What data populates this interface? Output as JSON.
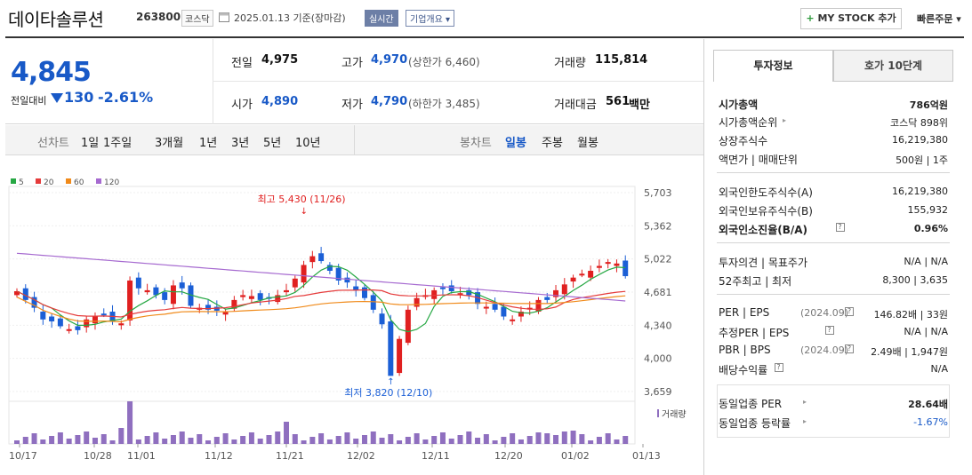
{
  "header": {
    "name": "데이타솔루션",
    "code": "263800",
    "market": "코스닥",
    "date": "2025.01.13 기준(장마감)",
    "live": "실시간",
    "corp": "기업개요 ▾",
    "mystock_plus": "+",
    "mystock": "MY STOCK 추가",
    "quick": "빠른주문 ▾"
  },
  "summary": {
    "price": "4,845",
    "chg_label": "전일대비",
    "chg": "130",
    "rate": "-2.61%",
    "prev_label": "전일",
    "prev": "4,975",
    "high_label": "고가",
    "high": "4,970",
    "upper": "(상한가 6,460)",
    "volume_label": "거래량",
    "volume": "115,814",
    "open_label": "시가",
    "open": "4,890",
    "low_label": "저가",
    "low": "4,790",
    "lower": "(하한가 3,485)",
    "amount_label": "거래대금",
    "amount": "561",
    "amount_unit": "백만"
  },
  "periods": {
    "line_title": "선차트",
    "line": [
      "1일",
      "1주일",
      "3개월",
      "1년",
      "3년",
      "5년",
      "10년"
    ],
    "candle_title": "봉차트",
    "candle": [
      "일봉",
      "주봉",
      "월봉"
    ],
    "candle_selected": 0
  },
  "chart_data": {
    "type": "candlestick",
    "legend": [
      {
        "name": "5",
        "color": "#27a844"
      },
      {
        "name": "20",
        "color": "#e53b3b"
      },
      {
        "name": "60",
        "color": "#f08a1a"
      },
      {
        "name": "120",
        "color": "#a66ad0"
      }
    ],
    "y_ticks": [
      "5,703",
      "5,362",
      "5,022",
      "4,681",
      "4,340",
      "4,000",
      "3,659"
    ],
    "ylim": [
      3659,
      5703
    ],
    "x_ticks": [
      "10/17",
      "10/28",
      "11/01",
      "11/12",
      "11/21",
      "12/02",
      "12/11",
      "12/20",
      "01/02",
      "01/13"
    ],
    "max_label": "최고 5,430 (11/26)",
    "min_label": "최저 3,820 (12/10)",
    "volume_label": "거래량",
    "up_color": "#e02020",
    "down_color": "#1b5fd6",
    "volume_color": "#8f6fbf"
  },
  "side": {
    "tab1": "투자정보",
    "tab2": "호가 10단계",
    "rows": [
      {
        "k": "시가총액",
        "v": "786억원",
        "bold": true
      },
      {
        "k": "시가총액순위",
        "v": "코스닥 898위",
        "arrow": true
      },
      {
        "k": "상장주식수",
        "v": "16,219,380"
      },
      {
        "k": "액면가 | 매매단위",
        "v": "500원 | 1주"
      },
      {
        "k": "외국인한도주식수(A)",
        "v": "16,219,380"
      },
      {
        "k": "외국인보유주식수(B)",
        "v": "155,932"
      },
      {
        "k": "외국인소진율(B/A)",
        "v": "0.96%",
        "bold": true,
        "q": true
      },
      {
        "k": "투자의견 | 목표주가",
        "v": "N/A | N/A"
      },
      {
        "k": "52주최고 | 최저",
        "v": "8,300 | 3,635"
      },
      {
        "k": "PER | EPS",
        "sub": "(2024.09)",
        "v": "146.82배 | 33원",
        "q": true
      },
      {
        "k": "추정PER | EPS",
        "v": "N/A | N/A",
        "q": true
      },
      {
        "k": "PBR | BPS",
        "sub": "(2024.09)",
        "v": "2.49배 | 1,947원",
        "q": true
      },
      {
        "k": "배당수익률",
        "v": "N/A",
        "q": true
      },
      {
        "k": "동일업종 PER",
        "v": "28.64배",
        "arrow": true
      },
      {
        "k": "동일업종 등락률",
        "v": "-1.67%",
        "arrow": true,
        "neg": true
      }
    ]
  }
}
